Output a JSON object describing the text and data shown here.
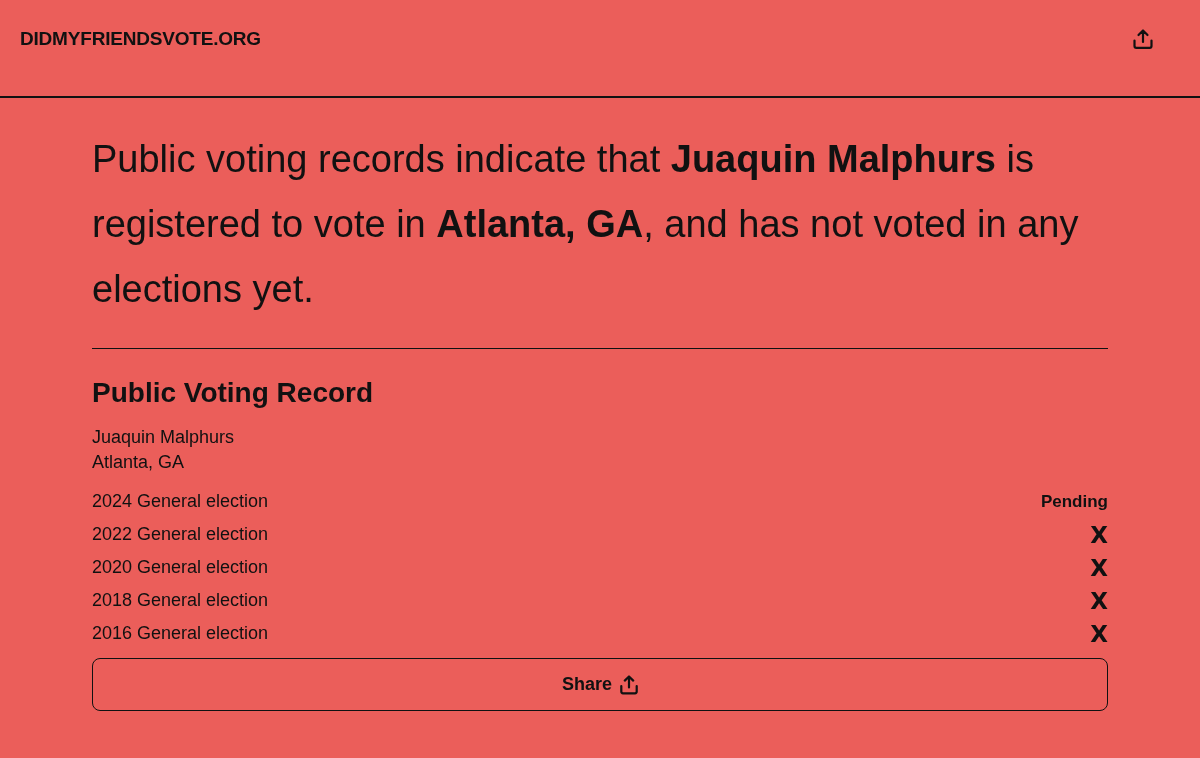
{
  "header": {
    "site_name": "DIDMYFRIENDSVOTE.ORG"
  },
  "summary": "Public voting records indicate that **Juaquin Malphurs** is registered to vote in **Atlanta, GA**, and has not voted in any elections yet.",
  "record": {
    "title": "Public Voting Record",
    "name": "Juaquin Malphurs",
    "location": "Atlanta, GA",
    "elections": [
      {
        "label": "2024 General election",
        "kind": "pending",
        "status": "Pending"
      },
      {
        "label": "2022 General election",
        "kind": "missed",
        "status": "X"
      },
      {
        "label": "2020 General election",
        "kind": "missed",
        "status": "X"
      },
      {
        "label": "2018 General election",
        "kind": "missed",
        "status": "X"
      },
      {
        "label": "2016 General election",
        "kind": "missed",
        "status": "X"
      }
    ]
  },
  "share_button": {
    "label": "Share"
  }
}
